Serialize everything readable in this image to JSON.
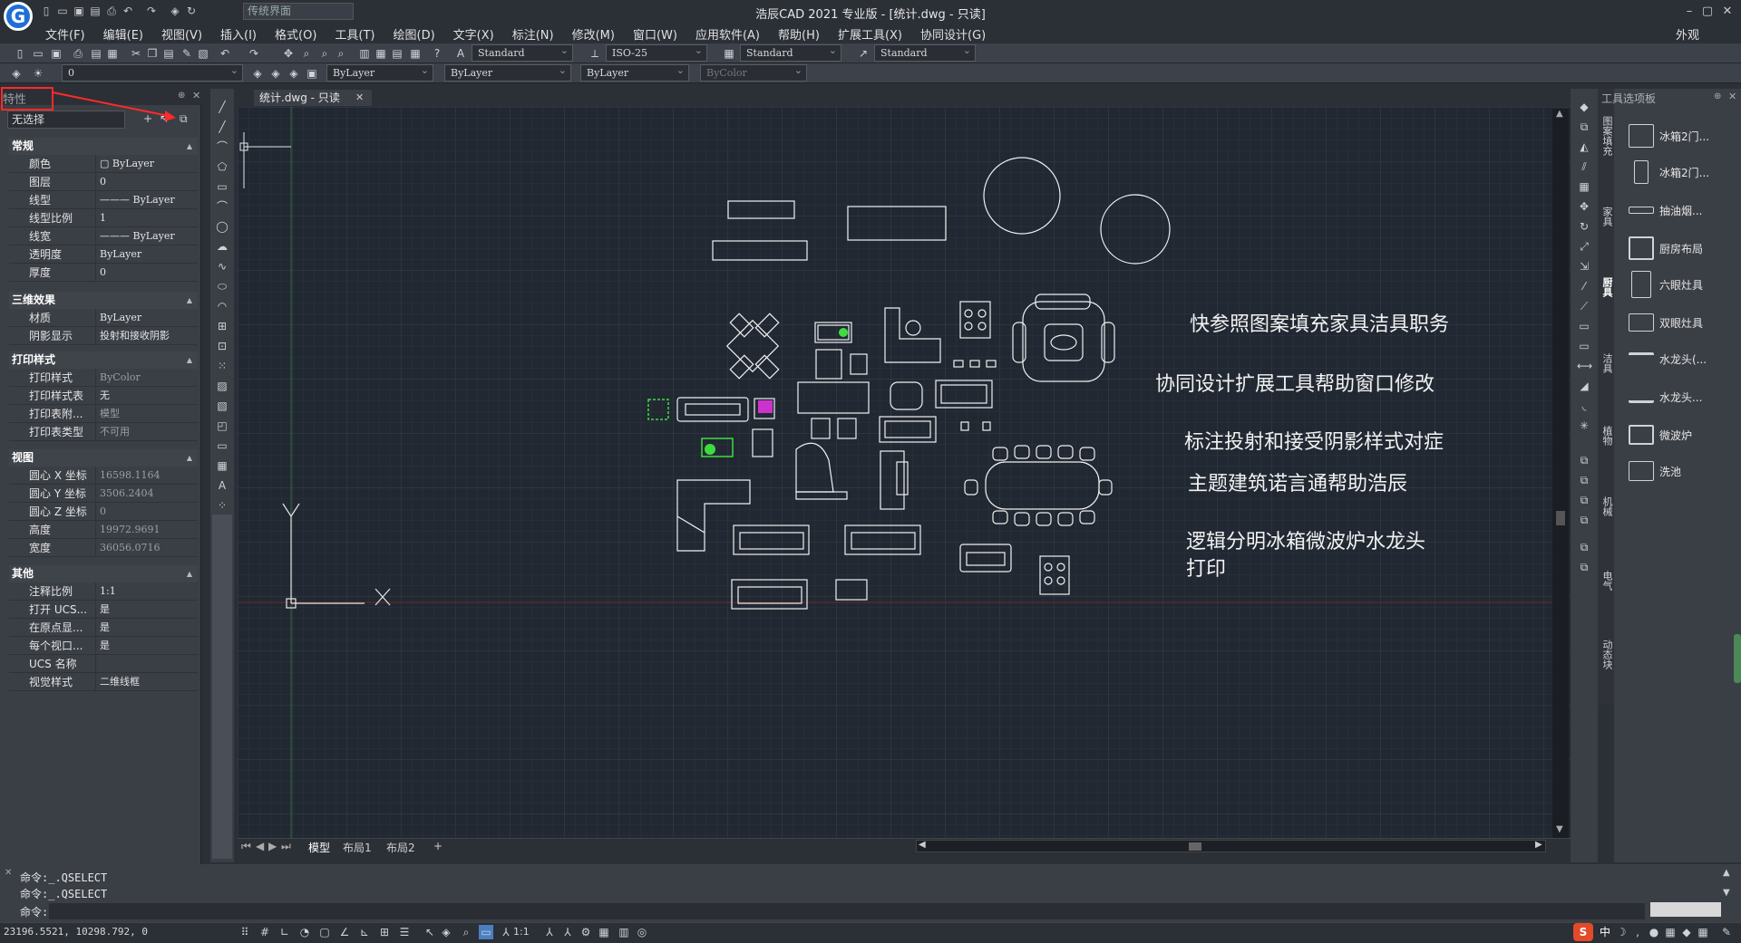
{
  "titlebar": {
    "workspace": "传统界面",
    "window_title": "浩辰CAD 2021 专业版 - [统计.dwg - 只读]"
  },
  "menu": [
    "文件(F)",
    "编辑(E)",
    "视图(V)",
    "插入(I)",
    "格式(O)",
    "工具(T)",
    "绘图(D)",
    "文字(X)",
    "标注(N)",
    "修改(M)",
    "窗口(W)",
    "应用软件(A)",
    "帮助(H)",
    "扩展工具(X)",
    "协同设计(G)"
  ],
  "appearance": "外观",
  "toolbar": {
    "text_style": "Standard",
    "dim_style": "ISO-25",
    "table_style": "Standard",
    "multileader_style": "Standard",
    "layer": "0",
    "color": "ByLayer",
    "linetype": "ByLayer",
    "lineweight": "ByLayer",
    "plot_style": "ByColor"
  },
  "properties": {
    "title": "特性",
    "selection": "无选择",
    "sections": {
      "general": {
        "title": "常规",
        "rows": [
          {
            "k": "颜色",
            "v": "ByLayer"
          },
          {
            "k": "图层",
            "v": "0"
          },
          {
            "k": "线型",
            "v": "ByLayer"
          },
          {
            "k": "线型比例",
            "v": "1"
          },
          {
            "k": "线宽",
            "v": "ByLayer"
          },
          {
            "k": "透明度",
            "v": "ByLayer"
          },
          {
            "k": "厚度",
            "v": "0"
          }
        ]
      },
      "three_d": {
        "title": "三维效果",
        "rows": [
          {
            "k": "材质",
            "v": "ByLayer"
          },
          {
            "k": "阴影显示",
            "v": "投射和接收阴影"
          }
        ]
      },
      "plot": {
        "title": "打印样式",
        "rows": [
          {
            "k": "打印样式",
            "v": "ByColor"
          },
          {
            "k": "打印样式表",
            "v": "无"
          },
          {
            "k": "打印表附...",
            "v": "模型"
          },
          {
            "k": "打印表类型",
            "v": "不可用"
          }
        ]
      },
      "view": {
        "title": "视图",
        "rows": [
          {
            "k": "圆心 X 坐标",
            "v": "16598.1164"
          },
          {
            "k": "圆心 Y 坐标",
            "v": "3506.2404"
          },
          {
            "k": "圆心 Z 坐标",
            "v": "0"
          },
          {
            "k": "高度",
            "v": "19972.9691"
          },
          {
            "k": "宽度",
            "v": "36056.0716"
          }
        ]
      },
      "other": {
        "title": "其他",
        "rows": [
          {
            "k": "注释比例",
            "v": "1:1"
          },
          {
            "k": "打开 UCS...",
            "v": "是"
          },
          {
            "k": "在原点显...",
            "v": "是"
          },
          {
            "k": "每个视口...",
            "v": "是"
          },
          {
            "k": "UCS 名称",
            "v": ""
          },
          {
            "k": "视觉样式",
            "v": "二维线框"
          }
        ]
      }
    }
  },
  "document": {
    "tab": "统计.dwg - 只读",
    "layouts": [
      "模型",
      "布局1",
      "布局2",
      "+"
    ]
  },
  "canvas_text": [
    "快参照图案填充家具洁具职务",
    "协同设计扩展工具帮助窗口修改",
    "标注投射和接受阴影样式对症",
    "主题建筑诺言通帮助浩辰",
    "逻辑分明冰箱微波炉水龙头",
    "打印"
  ],
  "palette": {
    "title": "工具选项板",
    "items": [
      "冰箱2门...",
      "冰箱2门...",
      "抽油烟...",
      "厨房布局",
      "六眼灶具",
      "双眼灶具",
      "水龙头(...",
      "水龙头...",
      "微波炉",
      "洗池"
    ],
    "tabs": [
      "图案填充",
      "家具",
      "厨具",
      "洁具",
      "植物",
      "机械",
      "电气",
      "动态块"
    ]
  },
  "command": {
    "lines": [
      "命令:_.QSELECT",
      "命令:_.QSELECT"
    ],
    "prompt": "命令:"
  },
  "status": {
    "coords": "23196.5521, 10298.792, 0",
    "scale": "1:1"
  },
  "colors": {
    "canvas": "#212832",
    "accent_red": "#ff2a2a",
    "entity_green": "#3fdc3f",
    "entity_magenta": "#cc33cc"
  }
}
